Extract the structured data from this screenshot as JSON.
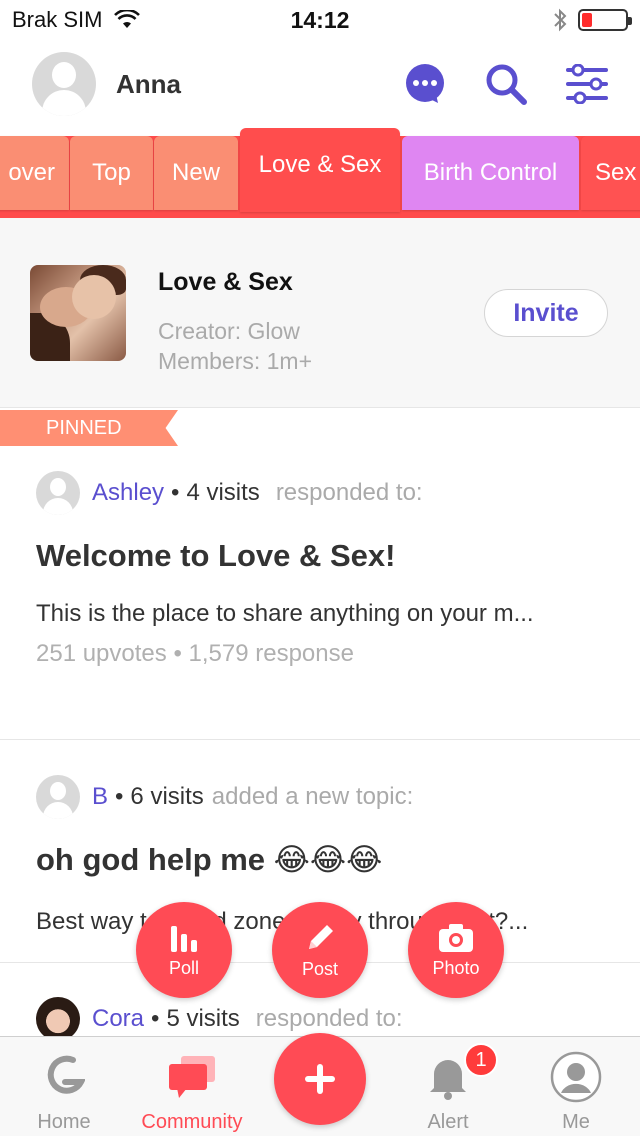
{
  "status_bar": {
    "carrier": "Brak SIM",
    "time": "14:12"
  },
  "header": {
    "username": "Anna",
    "icons": [
      "chat-bubble-icon",
      "search-icon",
      "filter-sliders-icon"
    ],
    "accent_color": "#5a4fcf"
  },
  "tabs": [
    {
      "label": "over"
    },
    {
      "label": "Top"
    },
    {
      "label": "New"
    },
    {
      "label": "Love & Sex",
      "active": true
    },
    {
      "label": "Birth Control"
    },
    {
      "label": "Sex"
    }
  ],
  "group": {
    "title": "Love & Sex",
    "creator": "Creator: Glow",
    "members": "Members: 1m+",
    "invite_label": "Invite"
  },
  "pinned_label": "PINNED",
  "posts": [
    {
      "author": "Ashley",
      "visits": "4 visits",
      "action": "responded to:",
      "title": "Welcome to Love & Sex!",
      "body": "This is the place to share anything on your m...",
      "stats": "251 upvotes • 1,579 response"
    },
    {
      "author": "B",
      "visits": "6 visits",
      "action": "added a new topic:",
      "title": "oh god help me 😂😂😂",
      "body": "Best way to friend zone suttley through text?..."
    },
    {
      "author": "Cora",
      "visits": "5 visits",
      "action": "responded to:"
    }
  ],
  "fab": {
    "poll": "Poll",
    "post": "Post",
    "photo": "Photo"
  },
  "bottom_nav": {
    "home": "Home",
    "community": "Community",
    "alert": "Alert",
    "me": "Me",
    "alert_badge": "1",
    "active": "community",
    "active_color": "#ff4b55"
  }
}
